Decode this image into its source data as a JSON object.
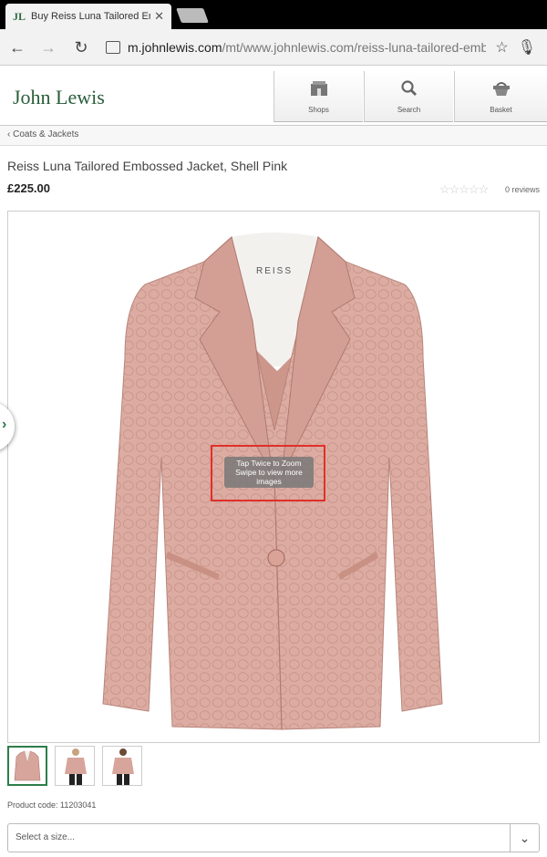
{
  "browser": {
    "tab_title": "Buy Reiss Luna Tailored Em",
    "tab_favicon_text": "JL",
    "url_host": "m.johnlewis.com",
    "url_path": "/mt/www.johnlewis.com/reiss-luna-tailored-emb",
    "icons": [
      "back-arrow-icon",
      "forward-arrow-icon",
      "reload-icon",
      "page-icon",
      "star-icon",
      "mic-icon",
      "close-icon"
    ]
  },
  "header": {
    "logo": "John Lewis",
    "shops_label": "Shops",
    "search_label": "Search",
    "basket_label": "Basket",
    "brand_color": "#2a5e3a"
  },
  "breadcrumb": {
    "label": "Coats & Jackets"
  },
  "product": {
    "title": "Reiss Luna Tailored Embossed Jacket, Shell Pink",
    "price": "£225.00",
    "stars": "☆☆☆☆☆",
    "reviews": "0 reviews",
    "code": "Product code: 11203041",
    "label_brand": "REISS",
    "hint_line1": "Tap Twice to Zoom",
    "hint_line2": "Swipe to view more images",
    "jacket_color": "#d9a89e",
    "hint_outline_color": "#e0302a"
  },
  "size": {
    "placeholder": "Select a size..."
  }
}
